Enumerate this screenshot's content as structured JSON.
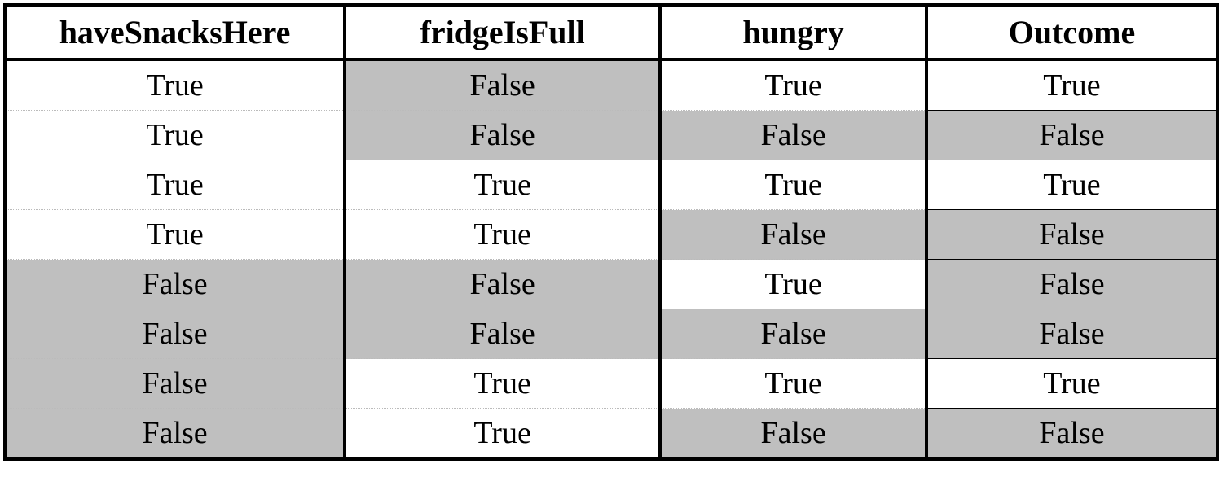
{
  "headers": {
    "c0": "haveSnacksHere",
    "c1": "fridgeIsFull",
    "c2": "hungry",
    "c3": "Outcome"
  },
  "rows": [
    {
      "c0": "True",
      "c1": "False",
      "c2": "True",
      "c3": "True"
    },
    {
      "c0": "True",
      "c1": "False",
      "c2": "False",
      "c3": "False"
    },
    {
      "c0": "True",
      "c1": "True",
      "c2": "True",
      "c3": "True"
    },
    {
      "c0": "True",
      "c1": "True",
      "c2": "False",
      "c3": "False"
    },
    {
      "c0": "False",
      "c1": "False",
      "c2": "True",
      "c3": "False"
    },
    {
      "c0": "False",
      "c1": "False",
      "c2": "False",
      "c3": "False"
    },
    {
      "c0": "False",
      "c1": "True",
      "c2": "True",
      "c3": "True"
    },
    {
      "c0": "False",
      "c1": "True",
      "c2": "False",
      "c3": "False"
    }
  ],
  "shading": [
    {
      "c0": false,
      "c1": true,
      "c2": false,
      "c3": false
    },
    {
      "c0": false,
      "c1": true,
      "c2": true,
      "c3": true
    },
    {
      "c0": false,
      "c1": false,
      "c2": false,
      "c3": false
    },
    {
      "c0": false,
      "c1": false,
      "c2": true,
      "c3": true
    },
    {
      "c0": true,
      "c1": true,
      "c2": false,
      "c3": true
    },
    {
      "c0": true,
      "c1": true,
      "c2": true,
      "c3": true
    },
    {
      "c0": true,
      "c1": false,
      "c2": false,
      "c3": false
    },
    {
      "c0": true,
      "c1": false,
      "c2": true,
      "c3": true
    }
  ]
}
